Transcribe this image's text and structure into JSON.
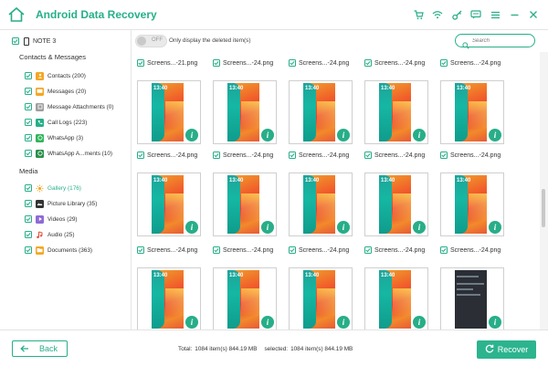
{
  "app": {
    "title": "Android Data Recovery",
    "accent_color": "#27ae88",
    "titlebar_icons": [
      "cart-icon",
      "wifi-icon",
      "key-icon",
      "chat-icon",
      "menu-icon",
      "minimize-icon",
      "close-icon"
    ]
  },
  "sidebar": {
    "device": {
      "label": "NOTE 3",
      "checked": true
    },
    "sections": [
      {
        "label": "Contacts & Messages",
        "items": [
          {
            "label": "Contacts (200)",
            "icon": "contacts-icon",
            "color": "#f5a623"
          },
          {
            "label": "Messages (20)",
            "icon": "messages-icon",
            "color": "#f5a623"
          },
          {
            "label": "Message Attachments (0)",
            "icon": "attachment-icon",
            "color": "#9e9e9e"
          },
          {
            "label": "Call Logs (223)",
            "icon": "phone-icon",
            "color": "#27ae88"
          },
          {
            "label": "WhatsApp (3)",
            "icon": "whatsapp-icon",
            "color": "#2fb55a"
          },
          {
            "label": "WhatsApp A...ments (10)",
            "icon": "whatsapp-icon",
            "color": "#2a8f4a"
          }
        ]
      },
      {
        "label": "Media",
        "items": [
          {
            "label": "Gallery (176)",
            "icon": "gallery-icon",
            "color": "#f5a623",
            "active": true
          },
          {
            "label": "Picture Library (35)",
            "icon": "picture-icon",
            "color": "#333333"
          },
          {
            "label": "Videos (29)",
            "icon": "video-icon",
            "color": "#8e6bd6"
          },
          {
            "label": "Audio (25)",
            "icon": "audio-icon",
            "color": "#e6543c"
          },
          {
            "label": "Documents (363)",
            "icon": "documents-icon",
            "color": "#f5a623"
          }
        ]
      }
    ]
  },
  "toolbar": {
    "toggle_label": "OFF",
    "filter_text": "Only display the deleted item(s)",
    "search_placeholder": "Search"
  },
  "grid": {
    "rows": [
      {
        "labels": [
          "Screens...-21.png",
          "Screens...-24.png",
          "Screens...-24.png",
          "Screens...-24.png",
          "Screens...-24.png"
        ]
      },
      {
        "labels": [
          "Screens...-24.png",
          "Screens...-24.png",
          "Screens...-24.png",
          "Screens...-24.png",
          "Screens...-24.png"
        ]
      },
      {
        "labels": [
          "Screens...-24.png",
          "Screens...-24.png",
          "Screens...-24.png",
          "Screens...-24.png",
          "Screens...-24.png"
        ]
      }
    ],
    "thumb_time": "13:40",
    "info_glyph": "i"
  },
  "footer": {
    "back_label": "Back",
    "total_label": "Total:",
    "total_value": "1084 item(s) 844.19 MB",
    "selected_label": "selected:",
    "selected_value": "1084 item(s) 844.19 MB",
    "recover_label": "Recover"
  }
}
